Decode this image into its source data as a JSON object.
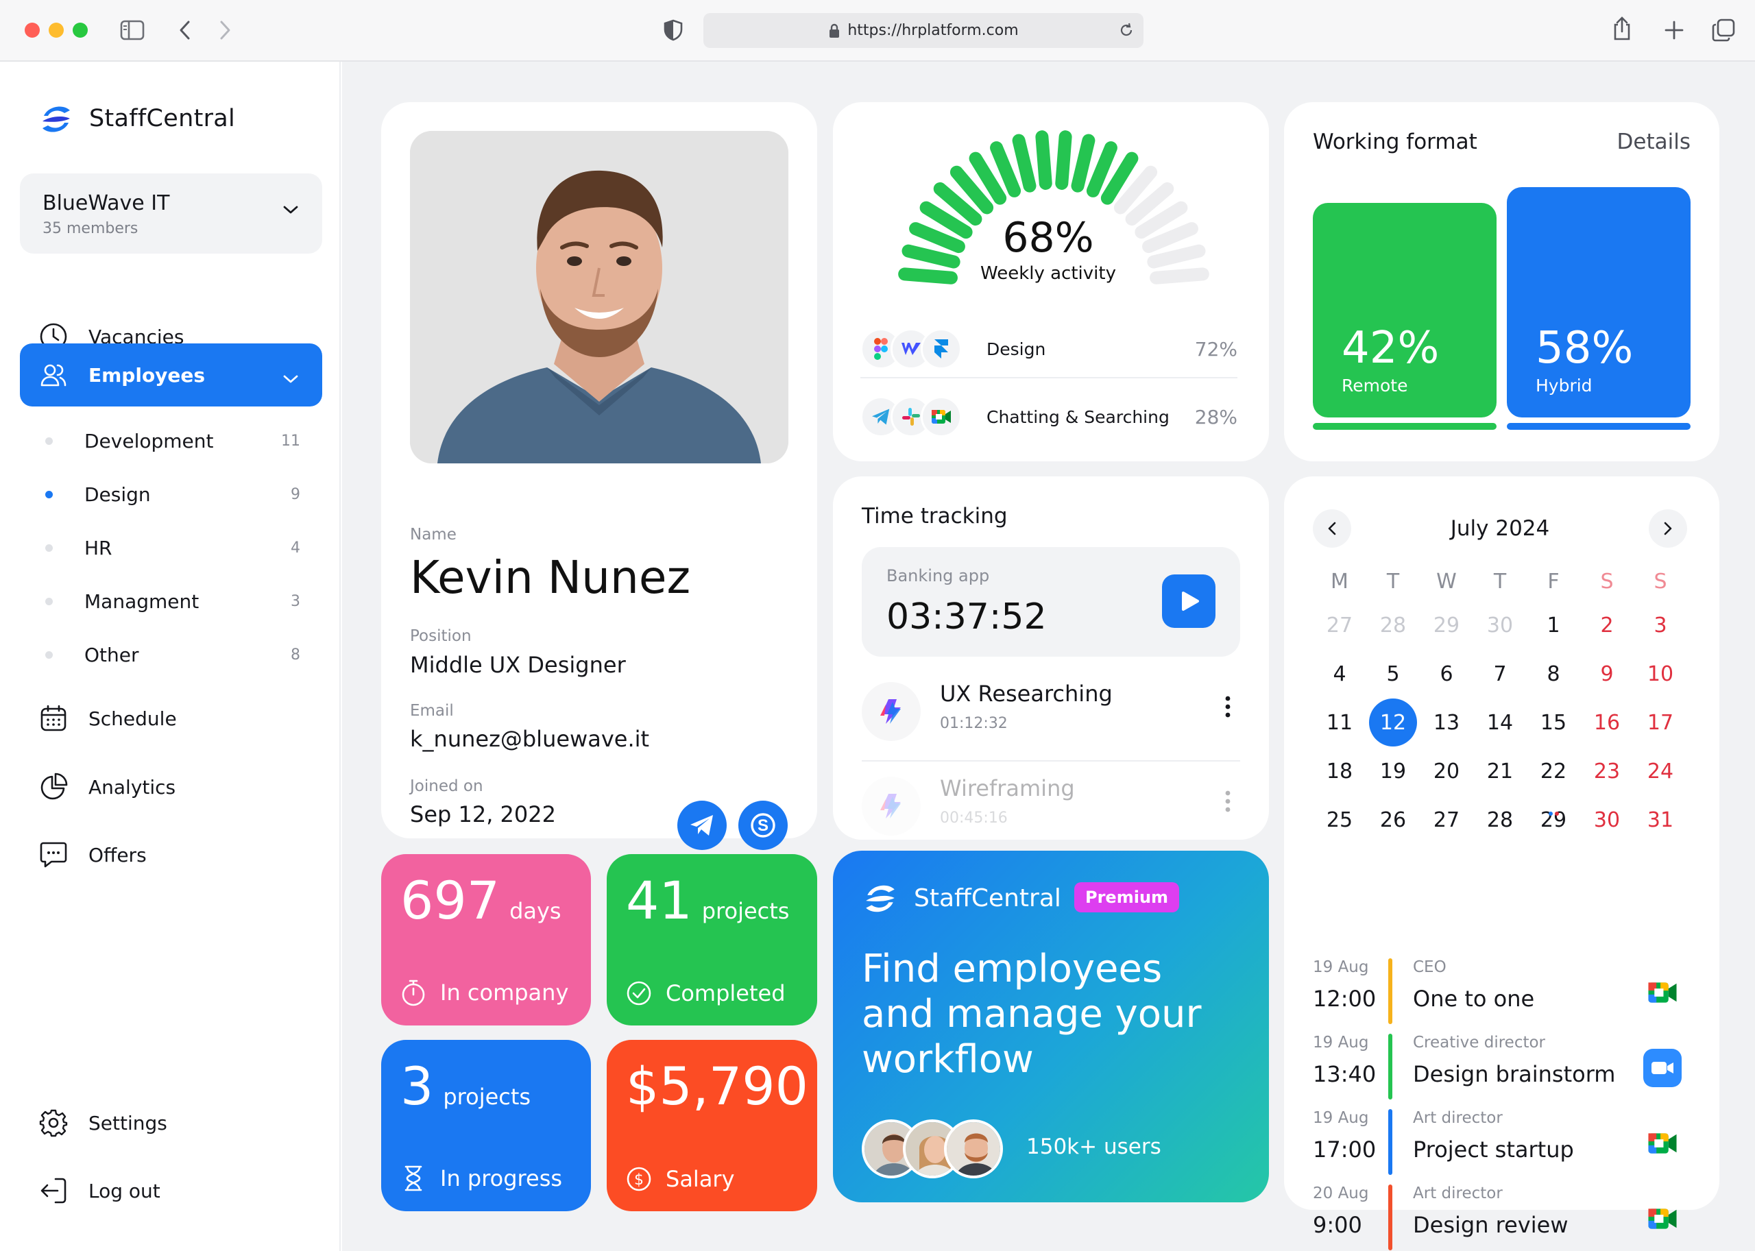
{
  "browser": {
    "url": "https://hrplatform.com"
  },
  "sidebar": {
    "brand": "StaffCentral",
    "org": {
      "name": "BlueWave IT",
      "members": "35 members"
    },
    "nav": [
      {
        "label": "Vacancies",
        "icon": "clock-icon"
      },
      {
        "label": "Employees",
        "icon": "users-icon",
        "active": true
      },
      {
        "label": "Schedule",
        "icon": "calendar-icon"
      },
      {
        "label": "Analytics",
        "icon": "pie-chart-icon"
      },
      {
        "label": "Offers",
        "icon": "chat-icon"
      }
    ],
    "departments": [
      {
        "label": "Development",
        "count": "11"
      },
      {
        "label": "Design",
        "count": "9",
        "selected": true
      },
      {
        "label": "HR",
        "count": "4"
      },
      {
        "label": "Managment",
        "count": "3"
      },
      {
        "label": "Other",
        "count": "8"
      }
    ],
    "bottom": [
      {
        "label": "Settings",
        "icon": "gear-icon"
      },
      {
        "label": "Log out",
        "icon": "logout-icon"
      }
    ]
  },
  "profile": {
    "name_label": "Name",
    "name": "Kevin Nunez",
    "position_label": "Position",
    "position": "Middle UX Designer",
    "email_label": "Email",
    "email": "k_nunez@bluewave.it",
    "joined_label": "Joined on",
    "joined": "Sep 12, 2022",
    "socials": [
      "telegram-icon",
      "skype-icon"
    ]
  },
  "activity": {
    "percent": "68%",
    "percent_value": 68,
    "label": "Weekly activity",
    "rows": [
      {
        "name": "Design",
        "percent": "72%",
        "apps": [
          "figma-icon",
          "webflow-icon",
          "framer-icon"
        ]
      },
      {
        "name": "Chatting & Searching",
        "percent": "28%",
        "apps": [
          "telegram-icon",
          "slack-icon",
          "google-meet-icon"
        ]
      }
    ]
  },
  "working_format": {
    "title": "Working format",
    "details": "Details",
    "bars": [
      {
        "percent": "42%",
        "label": "Remote",
        "value": 42,
        "color": "#25c451"
      },
      {
        "percent": "58%",
        "label": "Hybrid",
        "value": 58,
        "color": "#1a78f2"
      }
    ]
  },
  "time_tracking": {
    "title": "Time tracking",
    "current": {
      "app": "Banking app",
      "time": "03:37:52"
    },
    "tasks": [
      {
        "name": "UX Researching",
        "time": "01:12:32"
      },
      {
        "name": "Wireframing",
        "time": "00:45:16"
      }
    ]
  },
  "stats": [
    {
      "value": "697",
      "unit": "days",
      "label": "In company",
      "icon": "stopwatch-icon",
      "color": "#f2629f"
    },
    {
      "value": "41",
      "unit": "projects",
      "label": "Completed",
      "icon": "check-circle-icon",
      "color": "#25c451"
    },
    {
      "value": "3",
      "unit": "projects",
      "label": "In progress",
      "icon": "hourglass-icon",
      "color": "#1a78f2"
    },
    {
      "value": "$5,790",
      "unit": "",
      "label": "Salary",
      "icon": "dollar-icon",
      "color": "#fc4c24"
    }
  ],
  "promo": {
    "brand": "StaffCentral",
    "badge": "Premium",
    "headline": "Find employees and manage your workflow",
    "users": "150k+ users"
  },
  "calendar": {
    "month": "July 2024",
    "weekdays": [
      "M",
      "T",
      "W",
      "T",
      "F",
      "S",
      "S"
    ],
    "weeks": [
      [
        "27",
        "28",
        "29",
        "30",
        "1",
        "2",
        "3"
      ],
      [
        "4",
        "5",
        "6",
        "7",
        "8",
        "9",
        "10"
      ],
      [
        "11",
        "12",
        "13",
        "14",
        "15",
        "16",
        "17"
      ],
      [
        "18",
        "19",
        "20",
        "21",
        "22",
        "23",
        "24"
      ],
      [
        "25",
        "26",
        "27",
        "28",
        "29",
        "30",
        "31"
      ]
    ],
    "today": "12"
  },
  "events": [
    {
      "date": "19 Aug",
      "time": "12:00",
      "role": "CEO",
      "title": "One to one",
      "color": "#f6b21c",
      "icon": "google-meet-icon"
    },
    {
      "date": "19 Aug",
      "time": "13:40",
      "role": "Creative director",
      "title": "Design brainstorm",
      "color": "#25c451",
      "icon": "zoom-icon"
    },
    {
      "date": "19 Aug",
      "time": "17:00",
      "role": "Art director",
      "title": "Project startup",
      "color": "#1a78f2",
      "icon": "google-meet-icon"
    },
    {
      "date": "20 Aug",
      "time": "9:00",
      "role": "Art director",
      "title": "Design review",
      "color": "#f2502c",
      "icon": "google-meet-icon"
    }
  ]
}
